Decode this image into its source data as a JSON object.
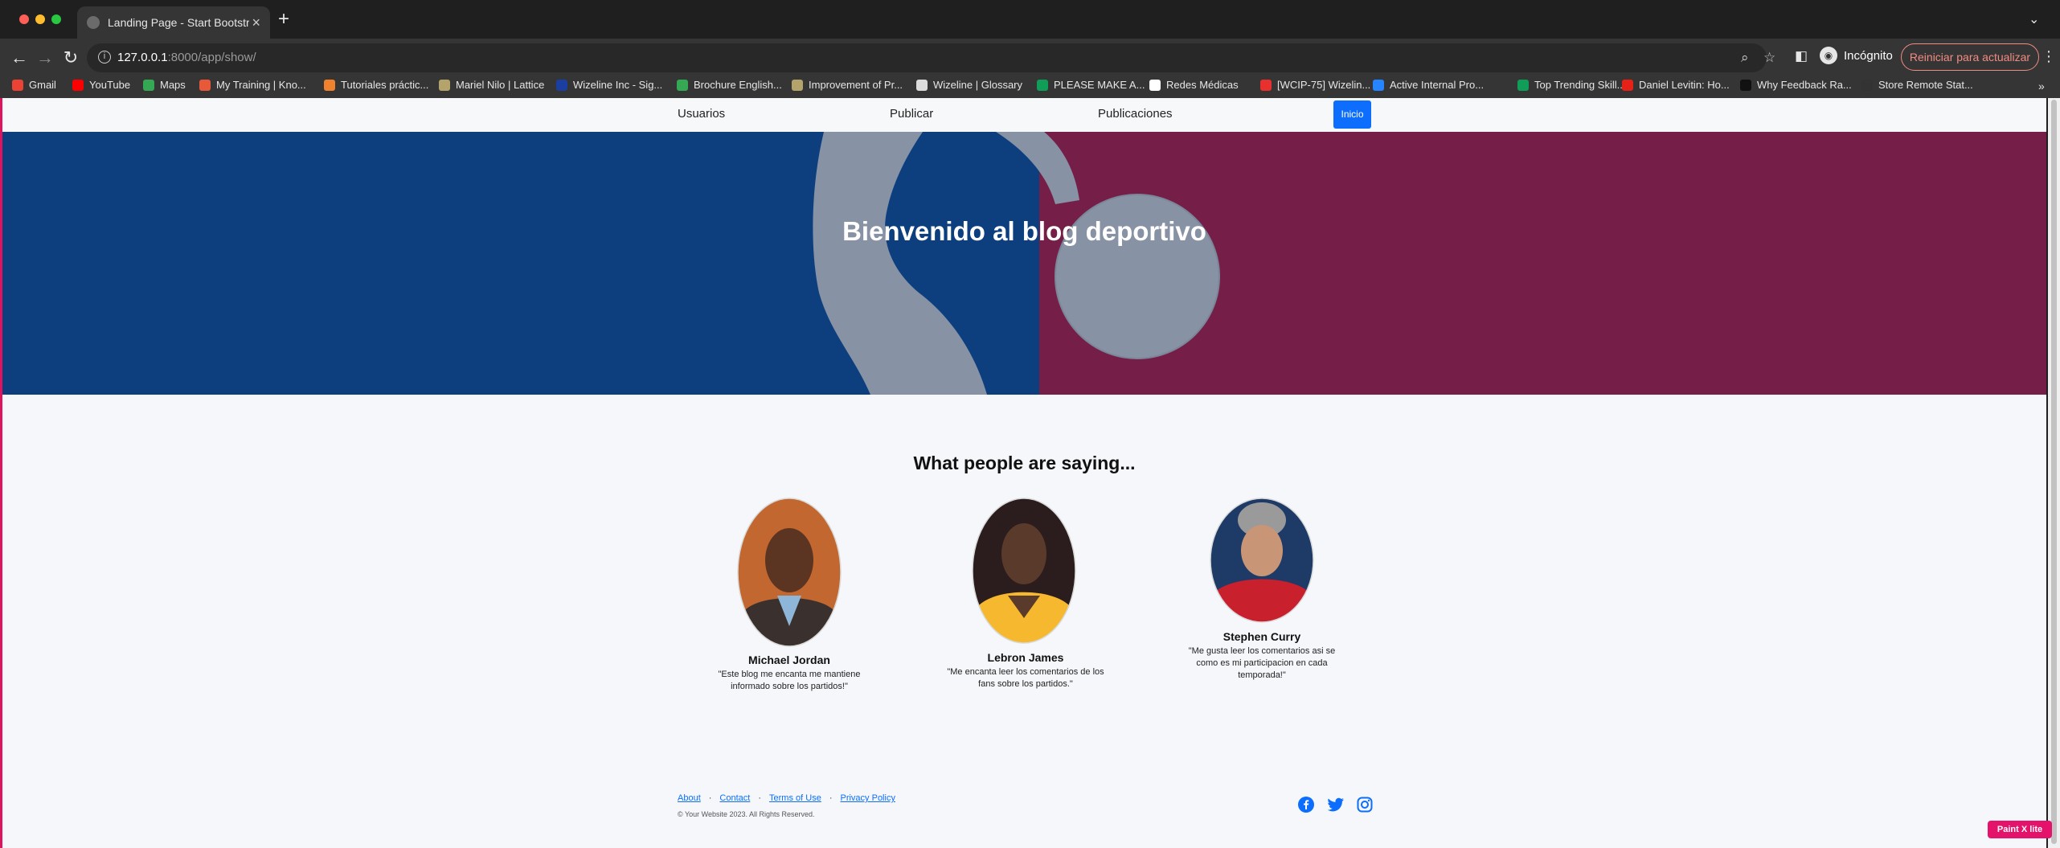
{
  "browser": {
    "tab_title": "Landing Page - Start Bootstrap",
    "new_tab_symbol": "+",
    "url_host": "127.0.0.1",
    "url_rest": ":8000/app/show/",
    "incognito_label": "Incógnito",
    "restart_label": "Reiniciar para actualizar",
    "bookmarks": [
      {
        "label": "Gmail",
        "color": "#ea4335"
      },
      {
        "label": "YouTube",
        "color": "#ff0000"
      },
      {
        "label": "Maps",
        "color": "#34a853"
      },
      {
        "label": "My Training | Kno...",
        "color": "#e8593a"
      },
      {
        "label": "Tutoriales práctic...",
        "color": "#f0812d"
      },
      {
        "label": "Mariel Nilo | Lattice",
        "color": "#b4a36a"
      },
      {
        "label": "Wizeline Inc - Sig...",
        "color": "#1b3fa0"
      },
      {
        "label": "Brochure English...",
        "color": "#34a853"
      },
      {
        "label": "Improvement of Pr...",
        "color": "#b4a36a"
      },
      {
        "label": "Wizeline | Glossary",
        "color": "#dcdcdc"
      },
      {
        "label": "PLEASE MAKE A...",
        "color": "#0f9d58"
      },
      {
        "label": "Redes Médicas",
        "color": "#ffffff"
      },
      {
        "label": "[WCIP-75] Wizelin...",
        "color": "#e8312f"
      },
      {
        "label": "Active Internal Pro...",
        "color": "#2684ff"
      },
      {
        "label": "Top Trending Skill...",
        "color": "#0f9d58"
      },
      {
        "label": "Daniel Levitin: Ho...",
        "color": "#e62117"
      },
      {
        "label": "Why Feedback Ra...",
        "color": "#111111"
      },
      {
        "label": "Store Remote Stat...",
        "color": "#333333"
      }
    ]
  },
  "site_nav": {
    "links": [
      "Usuarios",
      "Publicar",
      "Publicaciones"
    ],
    "button_label": "Inicio"
  },
  "hero": {
    "title": "Bienvenido al blog deportivo",
    "colors": {
      "left": "#0d3f7f",
      "right": "#751e47",
      "silhouette": "#8792a4"
    }
  },
  "testimonials": {
    "title": "What people are saying...",
    "people": [
      {
        "name": "Michael Jordan",
        "quote": "\"Este blog me encanta me mantiene informado sobre los partidos!\""
      },
      {
        "name": "Lebron James",
        "quote": "\"Me encanta leer los comentarios de los fans sobre los partidos.\""
      },
      {
        "name": "Stephen Curry",
        "quote": "\"Me gusta leer los comentarios asi se como es mi participacion en cada temporada!\""
      }
    ]
  },
  "footer": {
    "links": [
      "About",
      "Contact",
      "Terms of Use",
      "Privacy Policy"
    ],
    "separator": "·",
    "copyright": "© Your Website 2023. All Rights Reserved.",
    "social": [
      "facebook-icon",
      "twitter-icon",
      "instagram-icon"
    ]
  },
  "overlay_badge": "Paint X lite",
  "accent_color": "#0d6efd"
}
